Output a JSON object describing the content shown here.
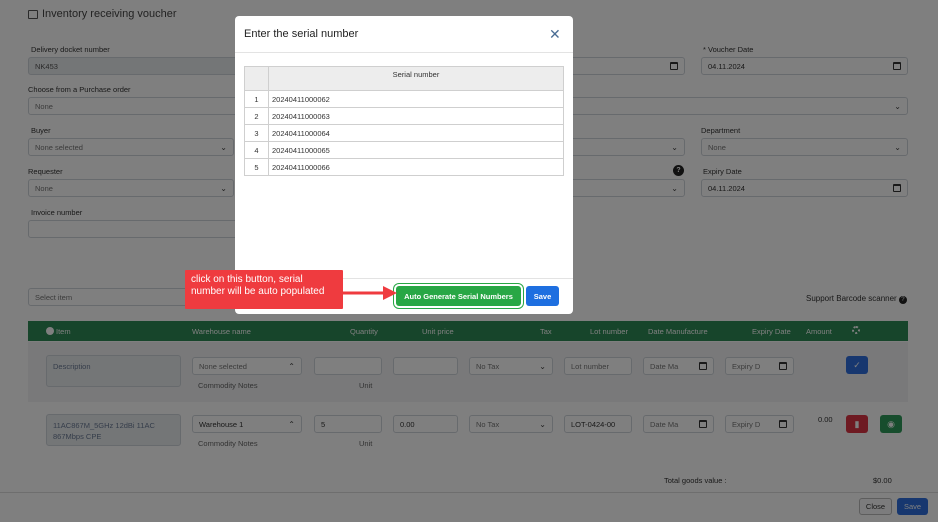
{
  "page": {
    "title": "Inventory receiving voucher",
    "fields": {
      "delivery_docket_label": "Delivery docket number",
      "delivery_docket_value": "NK453",
      "voucher_date_label": "* Voucher Date",
      "voucher_date_value": "04.11.2024",
      "purchase_order_label": "Choose from a Purchase order",
      "purchase_order_value": "None",
      "buyer_label": "Buyer",
      "buyer_value": "None selected",
      "department_label": "Department",
      "department_value": "None",
      "requester_label": "Requester",
      "requester_value": "None",
      "expiry_date_label": "Expiry Date",
      "expiry_date_value": "04.11.2024",
      "invoice_number_label": "Invoice number",
      "select_item_placeholder": "Select item",
      "support_barcode": "Support Barcode scanner"
    },
    "table": {
      "headers": [
        "Item",
        "Warehouse name",
        "Quantity",
        "Unit price",
        "Tax",
        "Lot number",
        "Date Manufacture",
        "Expiry Date",
        "Amount"
      ],
      "new_row": {
        "description_placeholder": "Description",
        "warehouse": "None selected",
        "commodity_notes": "Commodity Notes",
        "unit": "Unit",
        "tax": "No Tax",
        "lot_placeholder": "Lot number",
        "date_manufacture_placeholder": "Date Ma",
        "expiry_placeholder": "Expiry D"
      },
      "item_row": {
        "description": "11AC867M_5GHz 12dBi 11AC 867Mbps CPE",
        "warehouse": "Warehouse 1",
        "commodity_notes": "Commodity Notes",
        "quantity": "5",
        "unit": "Unit",
        "unit_price": "0.00",
        "tax": "No Tax",
        "lot": "LOT-0424-00",
        "date_manufacture_placeholder": "Date Ma",
        "expiry_placeholder": "Expiry D",
        "amount": "0.00"
      },
      "total_label": "Total goods value :",
      "total_value": "$0.00"
    },
    "footer": {
      "close": "Close",
      "save": "Save"
    }
  },
  "modal": {
    "title": "Enter the serial number",
    "column_header": "Serial number",
    "rows": [
      {
        "n": "1",
        "serial": "20240411000062"
      },
      {
        "n": "2",
        "serial": "20240411000063"
      },
      {
        "n": "3",
        "serial": "20240411000064"
      },
      {
        "n": "4",
        "serial": "20240411000065"
      },
      {
        "n": "5",
        "serial": "20240411000066"
      }
    ],
    "auto_generate_label": "Auto Generate Serial Numbers",
    "save_label": "Save"
  },
  "callout": {
    "text": "click on this button, serial number will be auto populated"
  },
  "colors": {
    "accent_green": "#28a745",
    "save_blue": "#1e6fe0",
    "callout_red": "#ef3b3f",
    "table_header_green": "#2f8a57"
  },
  "icons": [
    "close-icon",
    "calendar-icon",
    "chevron-down-icon",
    "help-icon",
    "check-icon",
    "trash-icon",
    "eye-icon",
    "gear-icon",
    "info-icon",
    "arrow-icon"
  ]
}
